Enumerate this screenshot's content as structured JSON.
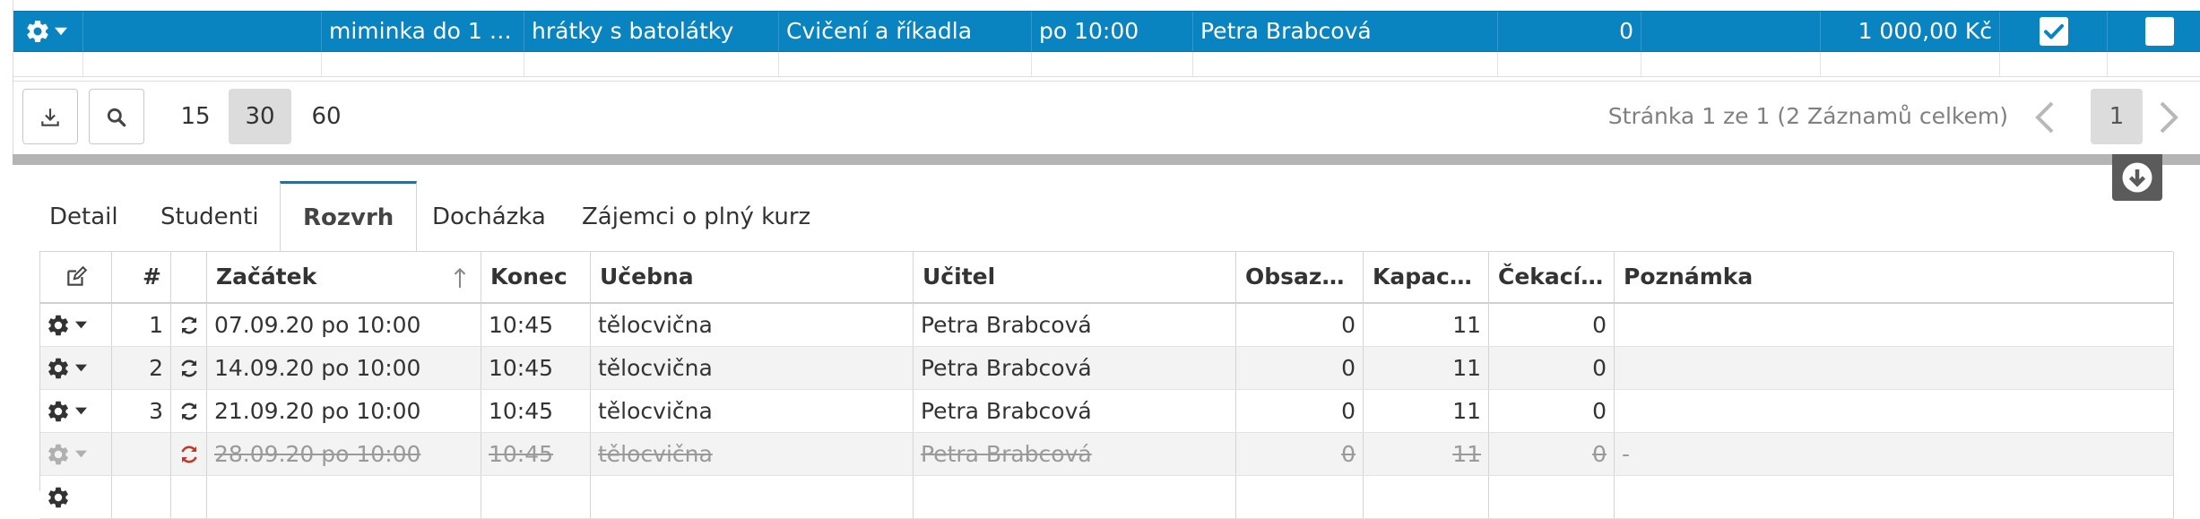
{
  "top_grid": {
    "selected_row": {
      "course_type": "miminka do 1 r...",
      "course_name": "hrátky s batolátky",
      "topic": "Cvičení a říkadla",
      "time": "po 10:00",
      "teacher": "Petra Brabcová",
      "count": "0",
      "price": "1 000,00 Kč",
      "check_1": true,
      "check_2": false
    }
  },
  "pager": {
    "page_sizes": [
      "15",
      "30",
      "60"
    ],
    "active_page_size": "30",
    "info": "Stránka 1 ze 1 (2 Záznamů celkem)",
    "current_page": "1"
  },
  "tabs": [
    {
      "label": "Detail",
      "active": false
    },
    {
      "label": "Studenti",
      "active": false
    },
    {
      "label": "Rozvrh",
      "active": true
    },
    {
      "label": "Docházka",
      "active": false
    },
    {
      "label": "Zájemci o plný kurz",
      "active": false
    }
  ],
  "schedule": {
    "columns": [
      "",
      "#",
      "",
      "Začátek",
      "Konec",
      "Učebna",
      "Učitel",
      "Obsazeno",
      "Kapacita",
      "Čekací l...",
      "Poznámka"
    ],
    "sort_indicator": "ascending",
    "rows": [
      {
        "num": "1",
        "start": "07.09.20 po 10:00",
        "end": "10:45",
        "room": "tělocvična",
        "teacher": "Petra Brabcová",
        "occupied": "0",
        "capacity": "11",
        "waiting": "0",
        "note": "",
        "cancelled": false
      },
      {
        "num": "2",
        "start": "14.09.20 po 10:00",
        "end": "10:45",
        "room": "tělocvična",
        "teacher": "Petra Brabcová",
        "occupied": "0",
        "capacity": "11",
        "waiting": "0",
        "note": "",
        "cancelled": false
      },
      {
        "num": "3",
        "start": "21.09.20 po 10:00",
        "end": "10:45",
        "room": "tělocvična",
        "teacher": "Petra Brabcová",
        "occupied": "0",
        "capacity": "11",
        "waiting": "0",
        "note": "",
        "cancelled": false
      },
      {
        "num": "",
        "start": "28.09.20 po 10:00",
        "end": "10:45",
        "room": "tělocvična",
        "teacher": "Petra Brabcová",
        "occupied": "0",
        "capacity": "11",
        "waiting": "0",
        "note": "-",
        "cancelled": true
      }
    ]
  },
  "colors": {
    "selected_row": "#0a83c1",
    "tab_active_border": "#2e6e96",
    "cancelled_sync": "#c0392b",
    "splitter": "#b4b4b4"
  },
  "icons": [
    "gear-icon",
    "caret-down-icon",
    "checkbox-checked-icon",
    "checkbox-empty-icon",
    "download-icon",
    "search-icon",
    "chevron-left-icon",
    "chevron-right-icon",
    "collapse-down-icon",
    "edit-icon",
    "sort-asc-icon",
    "sync-icon"
  ]
}
